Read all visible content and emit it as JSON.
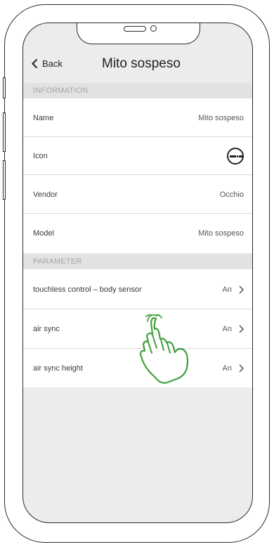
{
  "nav": {
    "back_label": "Back",
    "title": "Mito sospeso"
  },
  "sections": {
    "information": "INFORMATION",
    "parameter": "PARAMETER"
  },
  "info_rows": [
    {
      "label": "Name",
      "value": "Mito sospeso"
    },
    {
      "label": "Icon",
      "value": ""
    },
    {
      "label": "Vendor",
      "value": "Occhio"
    },
    {
      "label": "Model",
      "value": "Mito sospeso"
    }
  ],
  "param_rows": [
    {
      "label": "touchless control – body sensor",
      "value": "An"
    },
    {
      "label": "air sync",
      "value": "An"
    },
    {
      "label": "air sync height",
      "value": "An"
    }
  ],
  "icons": {
    "back": "chevron-left-icon",
    "row_disclosure": "chevron-right-icon",
    "device_icon": "pendant-light-icon",
    "gesture": "hand-pointer-icon"
  },
  "colors": {
    "gesture": "#3fa03a",
    "section_bg": "#e2e2e2",
    "screen_bg": "#ececec"
  }
}
